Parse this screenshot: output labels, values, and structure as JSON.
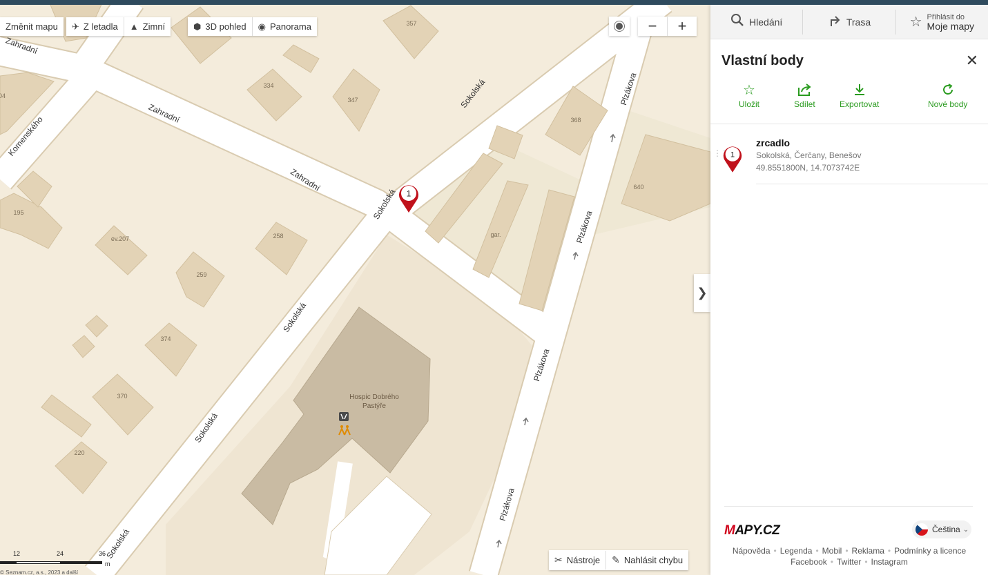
{
  "map": {
    "buttons": {
      "change_map": "Změnit mapu",
      "aerial": "Z letadla",
      "winter": "Zimní",
      "view_3d": "3D pohled",
      "panorama": "Panorama"
    },
    "zoom_out": "−",
    "zoom_in": "+",
    "expand_arrow": "❯",
    "tools": "Nástroje",
    "report_error": "Nahlásit chybu",
    "scale": {
      "labels": [
        "12",
        "24",
        "36"
      ],
      "unit": "m",
      "copyright": "© Seznam.cz, a.s., 2023 a další"
    },
    "streets": {
      "zahradni_1": "Zahradní",
      "zahradni_2": "Zahradní",
      "zahradni_3": "Zahradní",
      "komenskeho": "Komenského",
      "sokolska_1": "Sokolská",
      "sokolska_2": "Sokolská",
      "sokolska_3": "Sokolská",
      "sokolska_4": "Sokolská",
      "sokolska_5": "Sokolská",
      "plzakova_1": "Plzákova",
      "plzakova_2": "Plzákova",
      "plzakova_3": "Plzákova",
      "plzakova_4": "Plzákova"
    },
    "building_numbers": {
      "b357": "357",
      "b334": "334",
      "b347": "347",
      "b368": "368",
      "b640": "640",
      "b195": "195",
      "bev207": "ev.207",
      "b258": "258",
      "b259": "259",
      "b374": "374",
      "b370": "370",
      "b220": "220",
      "bgar": "gar.",
      "b04": "04"
    },
    "poi": {
      "hospic_line1": "Hospic Dobrého",
      "hospic_line2": "Pastýře"
    },
    "marker_number": "1",
    "colors": {
      "background": "#f4ecdc",
      "building": "#e3d3b6",
      "road": "#ffffff",
      "hospic": "#c9bba3",
      "marker": "#c0111b"
    }
  },
  "panel": {
    "nav": {
      "search": "Hledání",
      "route": "Trasa",
      "login_small": "Přihlásit do",
      "login_big": "Moje mapy"
    },
    "title": "Vlastní body",
    "close": "✕",
    "actions": {
      "save": "Uložit",
      "share": "Sdílet",
      "export": "Exportovat",
      "new_points": "Nové body"
    },
    "point": {
      "number": "1",
      "name": "zrcadlo",
      "address": "Sokolská, Čerčany, Benešov",
      "coords": "49.8551800N, 14.7073742E"
    },
    "logo": {
      "m": "M",
      "rest": "APY.CZ"
    },
    "language": "Čeština",
    "footer_links_1": [
      "Nápověda",
      "Legenda",
      "Mobil",
      "Reklama",
      "Podmínky a licence"
    ],
    "footer_links_2": [
      "Facebook",
      "Twitter",
      "Instagram"
    ]
  }
}
